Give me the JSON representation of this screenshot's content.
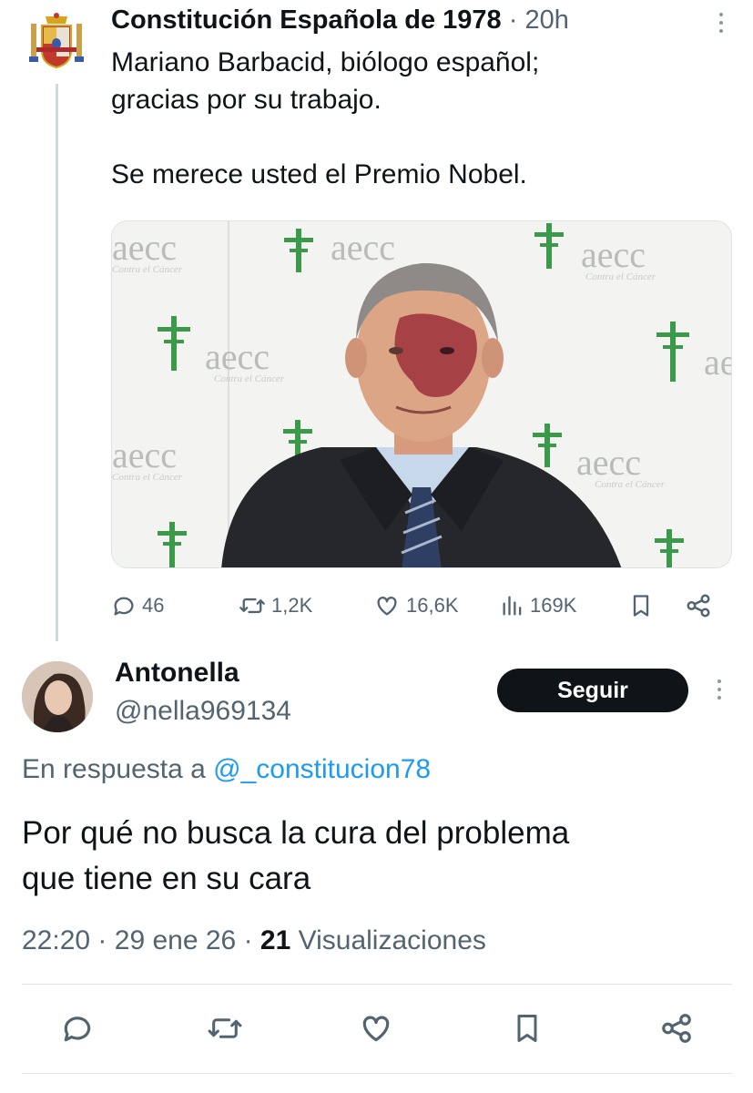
{
  "tweet": {
    "author_name": "Constitución Española de 1978",
    "separator": "·",
    "time": "20h",
    "text": "Mariano Barbacid, biólogo español;\ngracias por su trabajo.\n\nSe merece usted el Premio Nobel.",
    "photo_logo_text": "aecc",
    "photo_logo_subtext": "Contra el Cáncer",
    "stats": {
      "replies": "46",
      "retweets": "1,2K",
      "likes": "16,6K",
      "views": "169K"
    }
  },
  "reply": {
    "author_name": "Antonella",
    "handle": "@nella969134",
    "follow_label": "Seguir",
    "reply_prefix": "En respuesta a",
    "reply_mention": "@_constitucion78",
    "text": "Por qué no busca la cura del problema\nque tiene en su cara",
    "time": "22:20",
    "date": "29 ene 26",
    "views_count": "21",
    "views_label": "Visualizaciones",
    "dot": "·"
  },
  "colors": {
    "text": "#0f1419",
    "muted": "#536471",
    "link": "#1d9bf0",
    "logo_green": "#3a9a4a"
  }
}
